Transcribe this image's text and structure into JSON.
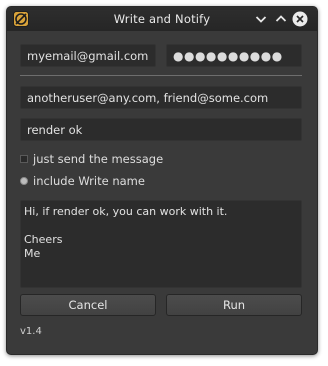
{
  "window": {
    "title": "Write and Notify",
    "icons": [
      "app-icon",
      "minimize-icon",
      "maximize-icon",
      "close-icon"
    ]
  },
  "account": {
    "email": "myemail@gmail.com",
    "password_masked": "●●●●●●●●●●"
  },
  "recipients": "anotheruser@any.com, friend@some.com",
  "subject": "render ok",
  "options": {
    "just_send": {
      "label": "just send the message",
      "checked": false
    },
    "include_name": {
      "label": "include Write name",
      "selected": true
    }
  },
  "message_lines": [
    "Hi, if render ok, you can work with it.",
    "",
    "Cheers",
    "Me"
  ],
  "buttons": {
    "cancel": "Cancel",
    "run": "Run"
  },
  "version": "v1.4",
  "colors": {
    "window_bg": "#3a3a3a",
    "field_bg": "#2c2c2c",
    "text": "#e2e2e2"
  }
}
